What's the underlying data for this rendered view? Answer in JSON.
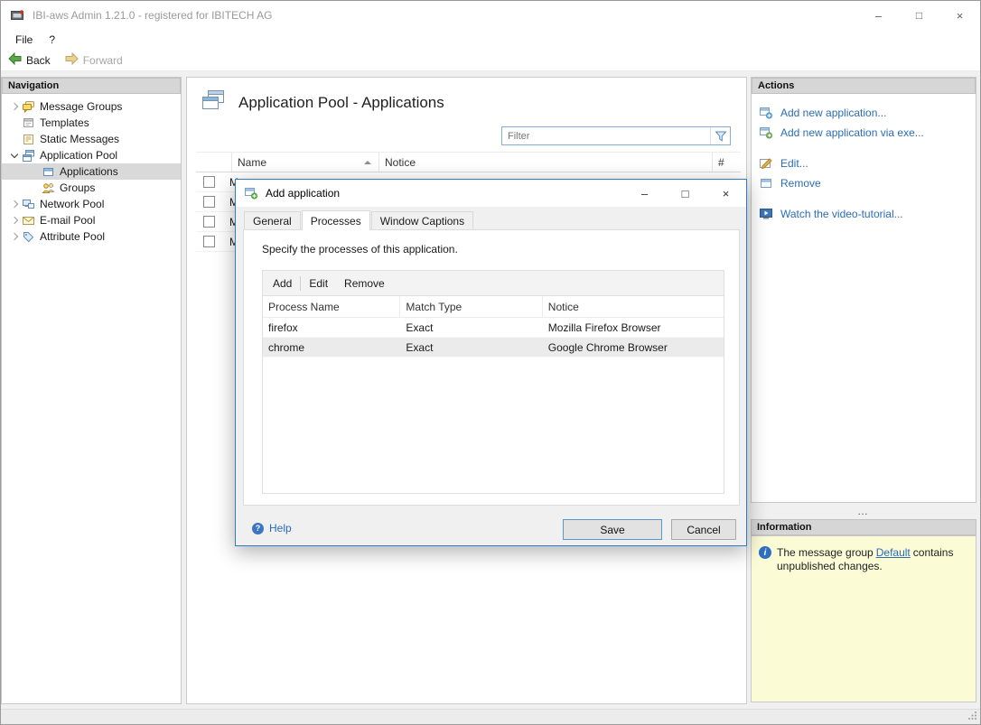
{
  "window": {
    "title": "IBI-aws Admin 1.21.0 - registered for IBITECH AG",
    "controls": {
      "minimize": "–",
      "maximize": "□",
      "close": "×"
    }
  },
  "menu": {
    "items": [
      {
        "label": "File"
      },
      {
        "label": "?"
      }
    ]
  },
  "toolbar": {
    "back_label": "Back",
    "forward_label": "Forward"
  },
  "navigation": {
    "header": "Navigation",
    "items": [
      {
        "label": "Message Groups"
      },
      {
        "label": "Templates"
      },
      {
        "label": "Static Messages"
      },
      {
        "label": "Application Pool"
      },
      {
        "label": "Applications"
      },
      {
        "label": "Groups"
      },
      {
        "label": "Network Pool"
      },
      {
        "label": "E-mail Pool"
      },
      {
        "label": "Attribute Pool"
      }
    ]
  },
  "main": {
    "title": "Application Pool - Applications",
    "filter": {
      "placeholder": "Filter"
    },
    "table": {
      "columns": {
        "name": "Name",
        "notice": "Notice",
        "count": "#"
      },
      "rows": [
        {
          "name": "M"
        },
        {
          "name": "M"
        },
        {
          "name": "M"
        },
        {
          "name": "M"
        }
      ]
    }
  },
  "actions": {
    "header": "Actions",
    "splitter_dots": "…",
    "items": [
      {
        "label": "Add new application..."
      },
      {
        "label": "Add new application via exe..."
      },
      {
        "label": "Edit..."
      },
      {
        "label": "Remove"
      },
      {
        "label": "Watch the video-tutorial..."
      }
    ]
  },
  "information": {
    "header": "Information",
    "text_before": "The message group",
    "link_label": "Default",
    "text_after": "contains unpublished changes."
  },
  "dialog": {
    "title": "Add application",
    "controls": {
      "minimize": "–",
      "maximize": "□",
      "close": "×"
    },
    "tabs": [
      {
        "label": "General"
      },
      {
        "label": "Processes"
      },
      {
        "label": "Window Captions"
      }
    ],
    "description": "Specify the processes of this application.",
    "toolbar": {
      "add": "Add",
      "edit": "Edit",
      "remove": "Remove"
    },
    "table": {
      "columns": {
        "process_name": "Process Name",
        "match_type": "Match Type",
        "notice": "Notice"
      },
      "rows": [
        {
          "process_name": "firefox",
          "match_type": "Exact",
          "notice": "Mozilla Firefox Browser"
        },
        {
          "process_name": "chrome",
          "match_type": "Exact",
          "notice": "Google Chrome Browser"
        }
      ]
    },
    "help_label": "Help",
    "save_label": "Save",
    "cancel_label": "Cancel"
  }
}
